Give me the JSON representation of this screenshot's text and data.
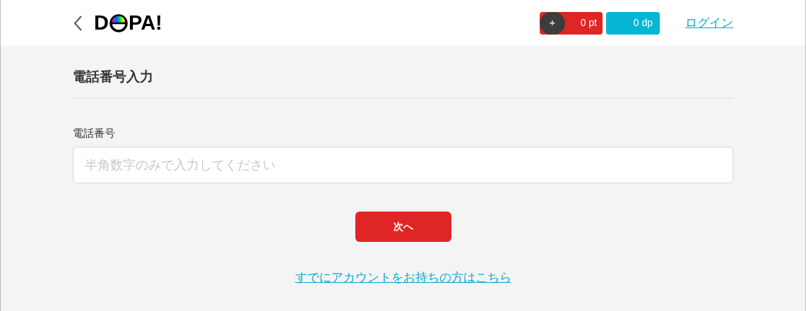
{
  "header": {
    "logo_parts": [
      "D",
      "PA!"
    ],
    "points": {
      "plus": "+",
      "value": "0 pt"
    },
    "dp": "0 dp",
    "login_link": "ログイン"
  },
  "page_title": "電話番号入力",
  "form": {
    "label": "電話番号",
    "placeholder": "半角数字のみで入力してください",
    "submit": "次へ"
  },
  "existing_account_link": "すでにアカウントをお持ちの方はこちら"
}
